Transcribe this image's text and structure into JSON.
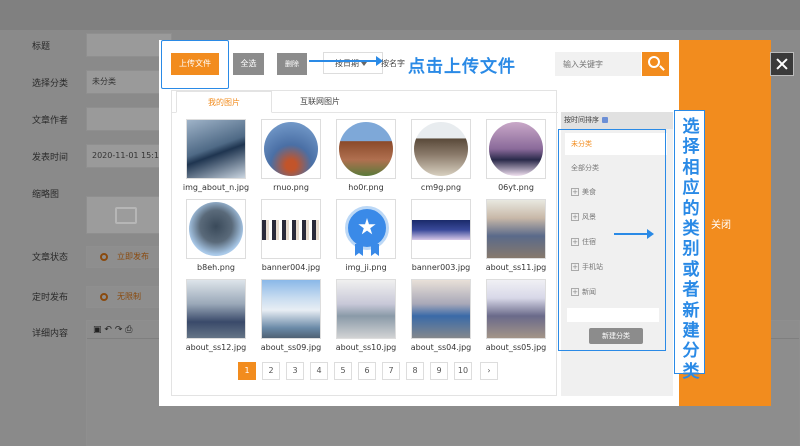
{
  "background_form": {
    "rows": [
      {
        "label": "标题",
        "value": ""
      },
      {
        "label": "选择分类",
        "value": "未分类"
      },
      {
        "label": "文章作者",
        "value": ""
      },
      {
        "label": "发表时间",
        "value": "2020-11-01 15:1"
      },
      {
        "label": "缩略图",
        "value": ""
      },
      {
        "label": "文章状态",
        "value": "立即发布"
      },
      {
        "label": "定时发布",
        "value": "无限制"
      },
      {
        "label": "详细内容",
        "value": ""
      }
    ]
  },
  "toolbar": {
    "upload_label": "上传文件",
    "select_all_label": "全选",
    "delete_label": "删除",
    "sort_date_label": "按日期",
    "sort_name_label": "按名字",
    "search_placeholder": "输入关键字"
  },
  "annotations": {
    "upload_hint": "点击上传文件",
    "category_hint": "选择相应的类别或者新建分类"
  },
  "tabs": [
    {
      "label": "我的图片"
    },
    {
      "label": "互联网图片"
    }
  ],
  "images": [
    {
      "name": "img_about_n.jpg"
    },
    {
      "name": "rnuo.png"
    },
    {
      "name": "ho0r.png"
    },
    {
      "name": "cm9g.png"
    },
    {
      "name": "06yt.png"
    },
    {
      "name": "b8eh.png"
    },
    {
      "name": "banner004.jpg"
    },
    {
      "name": "img_ji.png"
    },
    {
      "name": "banner003.jpg"
    },
    {
      "name": "about_ss11.jpg"
    },
    {
      "name": "about_ss12.jpg"
    },
    {
      "name": "about_ss09.jpg"
    },
    {
      "name": "about_ss10.jpg"
    },
    {
      "name": "about_ss04.jpg"
    },
    {
      "name": "about_ss05.jpg"
    }
  ],
  "pagination": {
    "pages": [
      "1",
      "2",
      "3",
      "4",
      "5",
      "6",
      "7",
      "8",
      "9",
      "10"
    ],
    "current": "1",
    "next_icon": "chevron-right-icon"
  },
  "categories": {
    "header": "按时间排序",
    "items": [
      {
        "label": "未分类",
        "selected": true,
        "expandable": false
      },
      {
        "label": "全部分类",
        "selected": false,
        "expandable": false
      },
      {
        "label": "美食",
        "selected": false,
        "expandable": true
      },
      {
        "label": "风景",
        "selected": false,
        "expandable": true
      },
      {
        "label": "住宿",
        "selected": false,
        "expandable": true
      },
      {
        "label": "手机站",
        "selected": false,
        "expandable": true
      },
      {
        "label": "新闻",
        "selected": false,
        "expandable": true
      }
    ],
    "new_button_label": "新建分类"
  },
  "close_panel": {
    "label": "关闭"
  },
  "colors": {
    "accent": "#f28c1e",
    "annotation": "#2a8ae6",
    "button_gray": "#8c8c8c"
  }
}
